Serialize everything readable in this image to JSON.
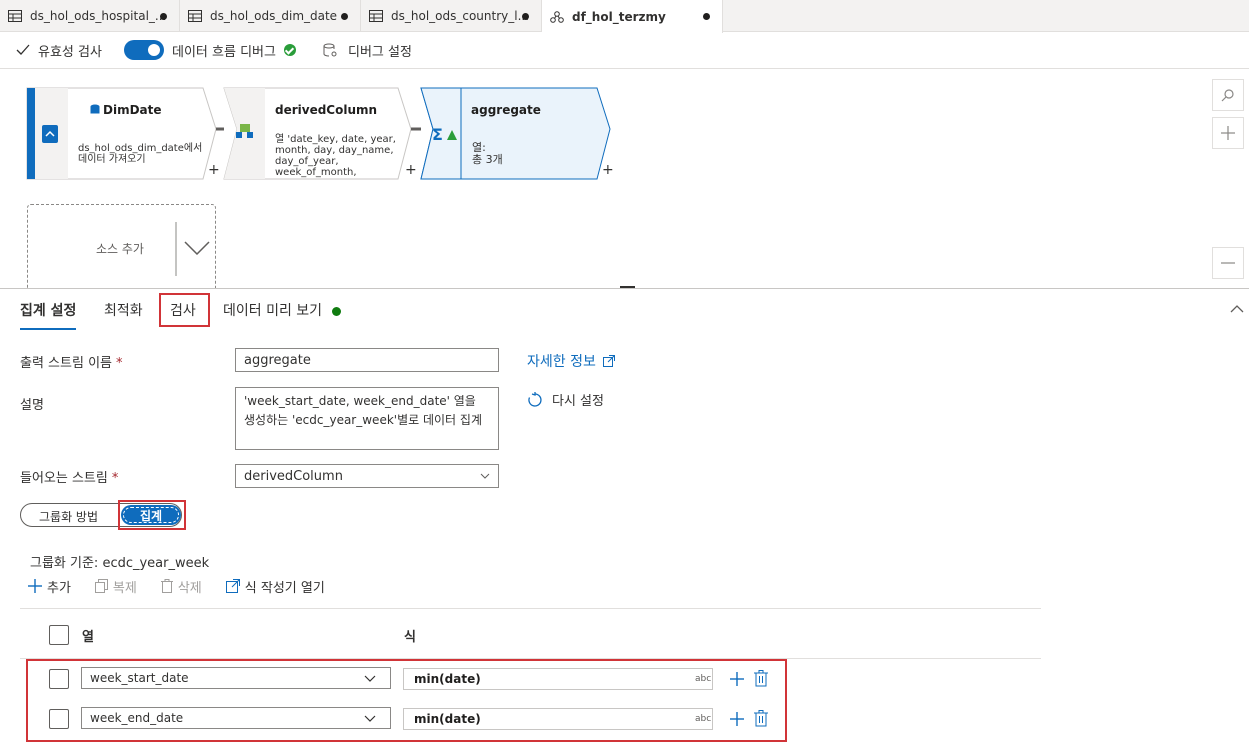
{
  "tabs": [
    {
      "label": "ds_hol_ods_hospital_...",
      "icon": "table-icon"
    },
    {
      "label": "ds_hol_ods_dim_date",
      "icon": "table-icon"
    },
    {
      "label": "ds_hol_ods_country_l...",
      "icon": "table-icon"
    },
    {
      "label": "df_hol_terzmy",
      "icon": "dataflow-icon"
    }
  ],
  "toolbar": {
    "validate": "유효성 검사",
    "debug": "데이터 흐름 디버그",
    "debug_settings": "디버그 설정"
  },
  "canvas": {
    "nodes": [
      {
        "title": "DimDate",
        "desc1": "ds_hol_ods_dim_date에서",
        "desc2": "데이터 가져오기"
      },
      {
        "title": "derivedColumn",
        "desc1": "열 'date_key, date, year,",
        "desc2": "month, day, day_name,",
        "desc3": "day_of_year,",
        "desc4": "week_of_month,"
      },
      {
        "title": "aggregate",
        "desc1": "열:",
        "desc2": "총 3개"
      }
    ],
    "plus": "+",
    "add_source": "소스 추가"
  },
  "settings_tabs": [
    {
      "label": "집계 설정"
    },
    {
      "label": "최적화"
    },
    {
      "label": "검사"
    },
    {
      "label": "데이터 미리 보기"
    }
  ],
  "form": {
    "output_stream_label": "출력 스트림 이름",
    "required_mark": "*",
    "output_stream_value": "aggregate",
    "learn_more": "자세한 정보",
    "description_label": "설명",
    "description_value": "'week_start_date, week_end_date' 열을 생성하는 'ecdc_year_week'별로 데이터 집계",
    "reset": "다시 설정",
    "incoming_stream_label": "들어오는 스트림",
    "incoming_stream_value": "derivedColumn"
  },
  "segmented": {
    "group_by": "그룹화 방법",
    "aggregates": "집계"
  },
  "group_by_text": "그룹화 기준: ecdc_year_week",
  "actions": {
    "add": "추가",
    "clone": "복제",
    "delete": "삭제",
    "open_builder": "식 작성기 열기"
  },
  "table": {
    "col_header": "열",
    "expr_header": "식",
    "type_tag": "abc",
    "rows": [
      {
        "column": "week_start_date",
        "expression": "min(date)"
      },
      {
        "column": "week_end_date",
        "expression": "min(date)"
      }
    ]
  },
  "colors": {
    "accent": "#0f6cbd",
    "highlight": "#d13438",
    "ok": "#2a9d3a"
  }
}
